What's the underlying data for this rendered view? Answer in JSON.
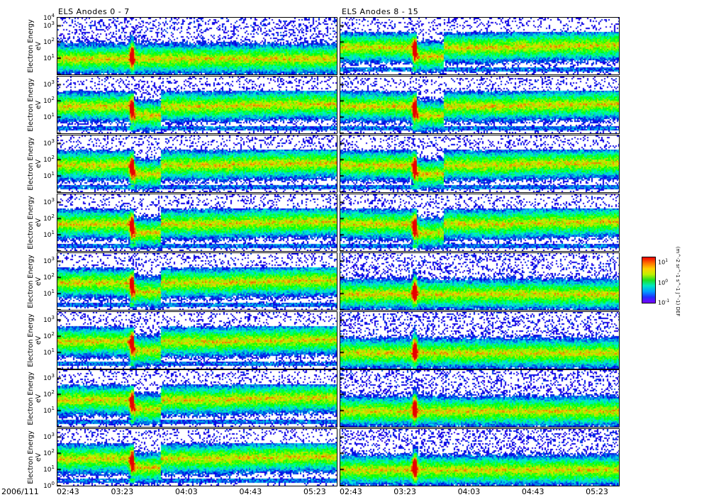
{
  "chart_data": {
    "type": "heatmap",
    "title_left": "ELS Anodes 0 - 7",
    "title_right": "ELS Anodes 8 - 15",
    "ylabel": "Electron Energy",
    "yunits": "eV",
    "ylim_log10": [
      0,
      3.5
    ],
    "ytick_labels": [
      "10^0",
      "10^1",
      "10^2",
      "10^3",
      "10^4"
    ],
    "date_label": "2006/111",
    "xtick_labels": [
      "02:43",
      "03:23",
      "04:03",
      "04:43",
      "05:23"
    ],
    "xlim_minutes_from_0243": [
      0,
      175
    ],
    "panels_left_anodes": [
      0,
      1,
      2,
      3,
      4,
      5,
      6,
      7
    ],
    "panels_right_anodes": [
      8,
      9,
      10,
      11,
      12,
      13,
      14,
      15
    ],
    "colorbar": {
      "tick_labels": [
        "10^-1",
        "10^0",
        "10^1"
      ],
      "label": "(m^-2 sr^-1 s^-1 J^-1) DEF",
      "colors": [
        "#7a00ff",
        "#2030ff",
        "#00a0ff",
        "#00e8c0",
        "#20e020",
        "#c0f000",
        "#ffd000",
        "#ff7000",
        "#f00000"
      ]
    }
  }
}
